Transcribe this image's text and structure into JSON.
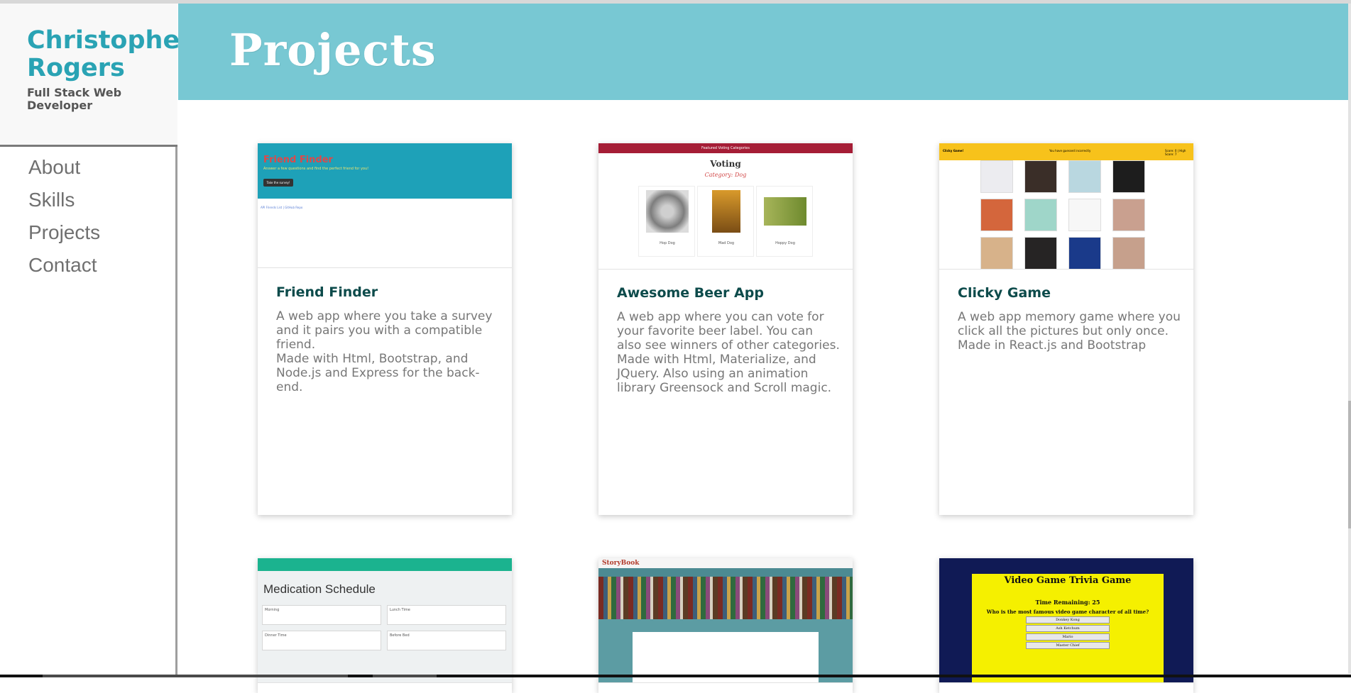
{
  "sidebar": {
    "name_line1": "Christopher",
    "name_line2": "Rogers",
    "subtitle": "Full Stack Web Developer",
    "nav": [
      "About",
      "Skills",
      "Projects",
      "Contact"
    ]
  },
  "header": {
    "title": "Projects"
  },
  "colors": {
    "accent": "#2aa3b4",
    "header_bg": "#78c8d3",
    "card_title": "#0d4b4b",
    "text_muted": "#777777"
  },
  "projects": [
    {
      "title": "Friend Finder",
      "desc": [
        "A web app where you take a survey and it pairs you with a compatible friend.",
        "Made with Html, Bootstrap, and Node.js and Express for the back-end."
      ],
      "thumb": {
        "heading": "Friend Finder",
        "sub": "Answer a few questions and find the perfect friend for you!",
        "button": "Take the survey!",
        "links": "API Friends List  |  GitHub Repo"
      }
    },
    {
      "title": "Awesome Beer App",
      "desc": [
        "A web app where you can vote for your favorite beer label. You can also see winners of other categories.",
        "Made with Html, Materialize, and JQuery. Also using an animation library Greensock and Scroll magic."
      ],
      "thumb": {
        "nav": "Featured    Voting    Categories",
        "heading": "Voting",
        "category": "Category: Dog",
        "items": [
          "Hop Dog",
          "Mad Dog",
          "Hoppy Dog"
        ]
      }
    },
    {
      "title": "Clicky Game",
      "desc": [
        "A web app memory game where you click all the pictures but only once.",
        "Made in React.js and Bootstrap"
      ],
      "thumb": {
        "left": "Clicky Game!",
        "center": "You have guessed incorrectly",
        "right": "Score: 0  |  High Score: 7"
      }
    },
    {
      "title": "",
      "desc": [],
      "thumb": {
        "heading": "Medication Schedule",
        "boxes": [
          "Morning",
          "Lunch Time",
          "Dinner Time",
          "Before Bed"
        ]
      }
    },
    {
      "title": "",
      "desc": [],
      "thumb": {
        "logo": "StoryBook"
      }
    },
    {
      "title": "",
      "desc": [],
      "thumb": {
        "heading": "Video Game Trivia Game",
        "remaining": "Time Remaining: 25",
        "question": "Who is the most famous video game character of all time?",
        "options": [
          "Donkey Kong",
          "Ash Ketchum",
          "Mario",
          "Master Chief"
        ]
      }
    }
  ]
}
